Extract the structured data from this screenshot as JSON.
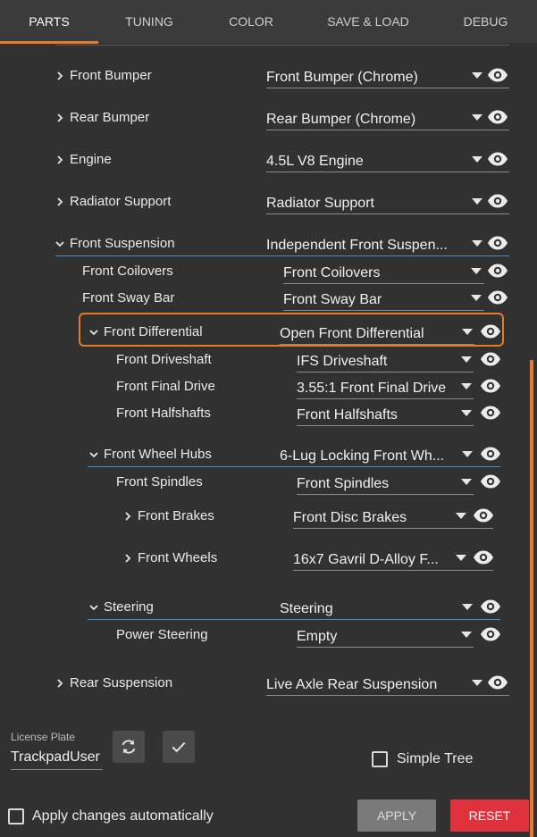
{
  "tabs": [
    {
      "label": "PARTS",
      "active": true
    },
    {
      "label": "TUNING"
    },
    {
      "label": "COLOR"
    },
    {
      "label": "SAVE & LOAD"
    },
    {
      "label": "DEBUG"
    }
  ],
  "tree": [
    {
      "label": "Front Bumper",
      "value": "Front Bumper (Chrome)",
      "expander": "collapsed"
    },
    {
      "label": "Rear Bumper",
      "value": "Rear Bumper (Chrome)",
      "expander": "collapsed"
    },
    {
      "label": "Engine",
      "value": "4.5L V8 Engine",
      "expander": "collapsed"
    },
    {
      "label": "Radiator Support",
      "value": "Radiator Support",
      "expander": "collapsed"
    },
    {
      "label": "Front Suspension",
      "value": "Independent Front Suspen...",
      "expander": "expanded"
    },
    {
      "label": "Front Coilovers",
      "value": "Front Coilovers"
    },
    {
      "label": "Front Sway Bar",
      "value": "Front Sway Bar"
    },
    {
      "label": "Front Differential",
      "value": "Open Front Differential",
      "expander": "expanded",
      "highlighted": true
    },
    {
      "label": "Front Driveshaft",
      "value": "IFS Driveshaft"
    },
    {
      "label": "Front Final Drive",
      "value": "3.55:1 Front Final Drive"
    },
    {
      "label": "Front Halfshafts",
      "value": "Front Halfshafts"
    },
    {
      "label": "Front Wheel Hubs",
      "value": "6-Lug Locking Front Wh...",
      "expander": "expanded"
    },
    {
      "label": "Front Spindles",
      "value": "Front Spindles"
    },
    {
      "label": "Front Brakes",
      "value": "Front Disc Brakes",
      "expander": "collapsed"
    },
    {
      "label": "Front Wheels",
      "value": "16x7 Gavril D-Alloy F...",
      "expander": "collapsed"
    },
    {
      "label": "Steering",
      "value": "Steering",
      "expander": "expanded"
    },
    {
      "label": "Power Steering",
      "value": "Empty"
    },
    {
      "label": "Rear Suspension",
      "value": "Live Axle Rear Suspension",
      "expander": "collapsed"
    }
  ],
  "license_plate": {
    "label": "License Plate",
    "value": "TrackpadUser",
    "refresh_icon": "refresh-icon",
    "confirm_icon": "check-icon"
  },
  "simple_tree": {
    "label": "Simple Tree",
    "checked": false
  },
  "apply_auto": {
    "label": "Apply changes automatically",
    "checked": false
  },
  "buttons": {
    "apply": "APPLY",
    "reset": "RESET"
  },
  "colors": {
    "accent": "#e77a2d",
    "reset": "#e0323c",
    "background": "#313131",
    "link_line": "#4a90c8"
  }
}
